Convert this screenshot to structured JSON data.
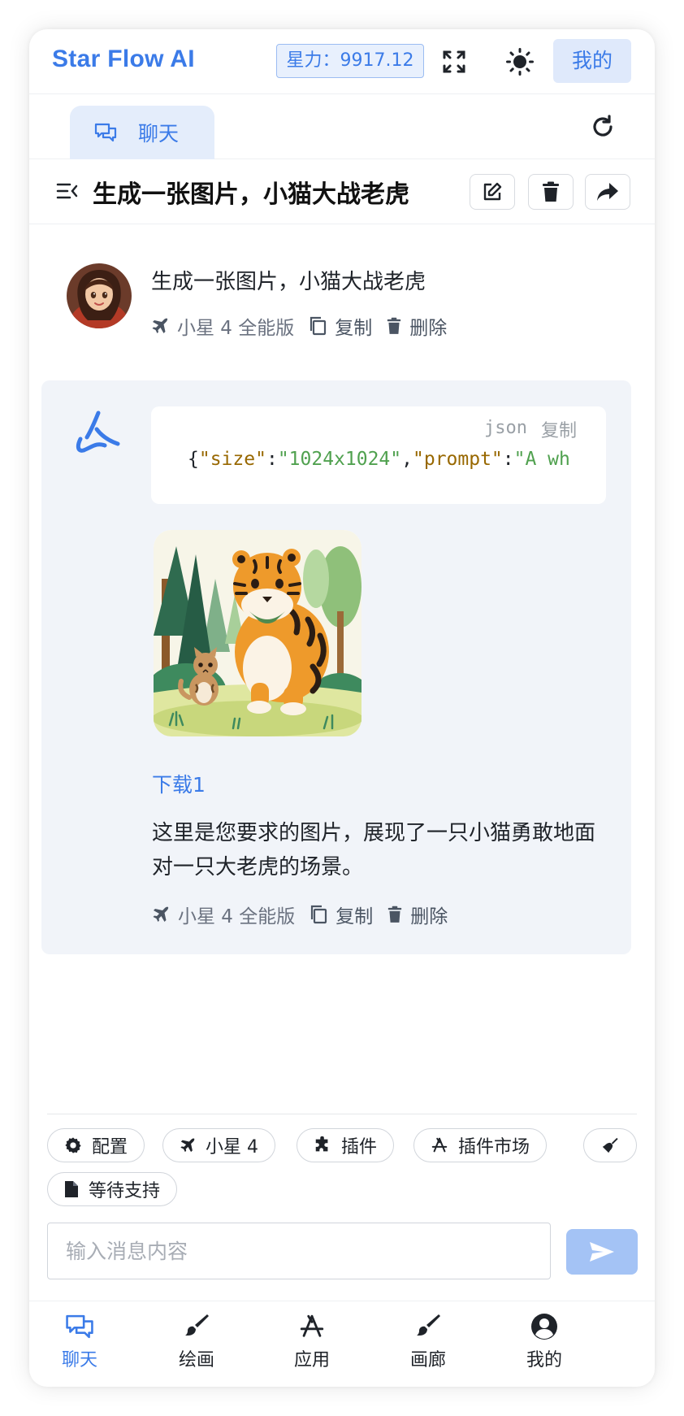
{
  "header": {
    "brand": "Star Flow AI",
    "power_label": "星力：9917.12",
    "mine_label": "我的"
  },
  "tabs": {
    "chat_label": "聊天"
  },
  "conversation": {
    "title": "生成一张图片，小猫大战老虎"
  },
  "user_message": {
    "text": "生成一张图片，小猫大战老虎",
    "model": "小星 4 全能版",
    "copy_label": "复制",
    "delete_label": "删除"
  },
  "assistant_message": {
    "code_lang": "json",
    "code_copy_label": "复制",
    "code_parts": {
      "open": "{",
      "k1": "\"size\"",
      "colon1": ":",
      "v1": "\"1024x1024\"",
      "comma": ",",
      "k2": "\"prompt\"",
      "colon2": ":",
      "v2": "\"A wh"
    },
    "download_label": "下载1",
    "text": "这里是您要求的图片，展现了一只小猫勇敢地面对一只大老虎的场景。",
    "model": "小星 4 全能版",
    "copy_label": "复制",
    "delete_label": "删除"
  },
  "toolbar": {
    "config": "配置",
    "model": "小星 4",
    "plugins": "插件",
    "plugin_market": "插件市场",
    "pending": "等待支持"
  },
  "input": {
    "placeholder": "输入消息内容"
  },
  "bottom_nav": {
    "chat": "聊天",
    "draw": "绘画",
    "apps": "应用",
    "gallery": "画廊",
    "mine": "我的"
  },
  "colors": {
    "accent": "#3b7be8",
    "assistant_bg": "#f1f4f9",
    "send_disabled": "#a4c3f5"
  }
}
